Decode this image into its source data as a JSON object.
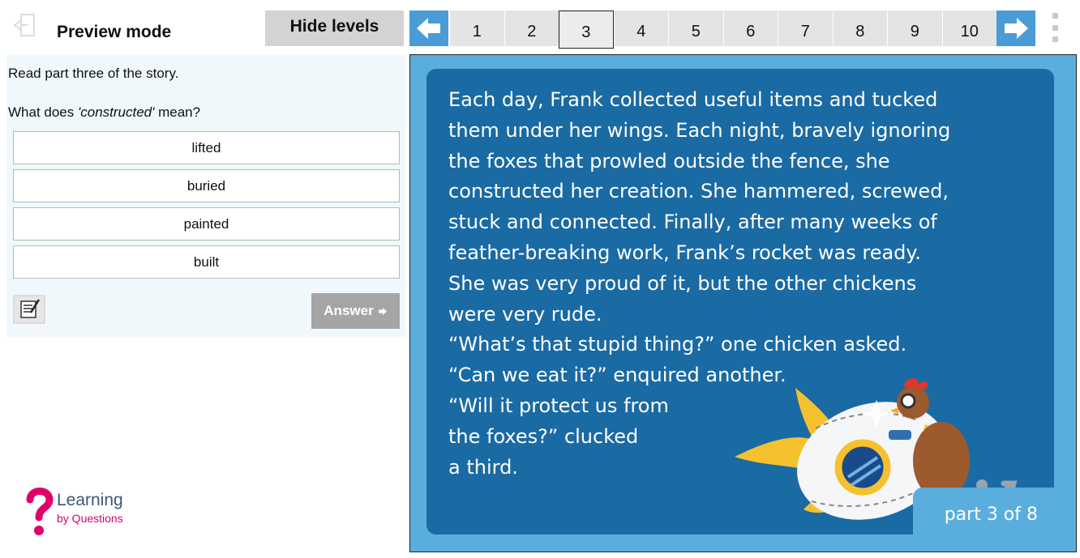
{
  "header": {
    "mode_label": "Preview mode",
    "hide_levels_label": "Hide levels",
    "levels": [
      "1",
      "2",
      "3",
      "4",
      "5",
      "6",
      "7",
      "8",
      "9",
      "10"
    ],
    "current_level": "3",
    "icons": {
      "exit": "exit-door-icon",
      "prev": "arrow-left-icon",
      "next": "arrow-right-icon",
      "more": "more-vertical-icon"
    },
    "accent_color": "#4a9bd6"
  },
  "question": {
    "instruction": "Read part three of the story.",
    "prompt_before": "What does ",
    "prompt_word": "'constructed'",
    "prompt_after": " mean?",
    "options": [
      "lifted",
      "buried",
      "painted",
      "built"
    ],
    "answer_label": "Answer",
    "notes_icon": "notepad-icon"
  },
  "logo": {
    "line1": "Learning",
    "line2": "by Questions"
  },
  "story": {
    "text": "Each day, Frank collected useful items and tucked\nthem under her wings. Each night, bravely ignoring\nthe foxes that prowled outside the fence, she\nconstructed her creation. She hammered, screwed,\nstuck and connected. Finally, after many weeks of\nfeather-breaking work, Frank’s rocket was ready.\nShe was very proud of it, but the other chickens\nwere very rude.\n“What’s that stupid thing?” one chicken asked.\n“Can we eat it?” enquired another.\n“Will it protect us from\nthe foxes?” clucked\na third.",
    "part_label": "part 3 of 8",
    "colors": {
      "card": "#1a6aa4",
      "frame": "#5aaede"
    }
  }
}
